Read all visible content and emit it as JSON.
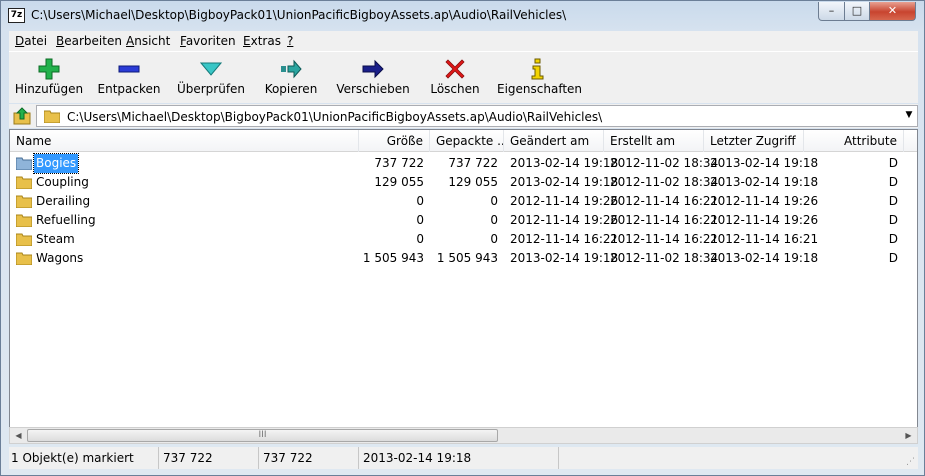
{
  "window": {
    "title": "C:\\Users\\Michael\\Desktop\\BigboyPack01\\UnionPacificBigboyAssets.ap\\Audio\\RailVehicles\\",
    "app_icon_text": "7z",
    "min_glyph": "–",
    "max_glyph": "□",
    "close_glyph": "✕"
  },
  "menu": [
    {
      "label": "Datei",
      "mnemonic": "D"
    },
    {
      "label": "Bearbeiten",
      "mnemonic": "B"
    },
    {
      "label": "Ansicht",
      "mnemonic": "A"
    },
    {
      "label": "Favoriten",
      "mnemonic": "F"
    },
    {
      "label": "Extras",
      "mnemonic": "E"
    },
    {
      "label": "?",
      "mnemonic": "?"
    }
  ],
  "toolbar": [
    {
      "label": "Hinzufügen",
      "icon": "add-icon"
    },
    {
      "label": "Entpacken",
      "icon": "extract-icon"
    },
    {
      "label": "Überprüfen",
      "icon": "test-icon"
    },
    {
      "label": "Kopieren",
      "icon": "copy-icon"
    },
    {
      "label": "Verschieben",
      "icon": "move-icon"
    },
    {
      "label": "Löschen",
      "icon": "delete-icon"
    },
    {
      "label": "Eigenschaften",
      "icon": "info-icon"
    }
  ],
  "address": {
    "path": "C:\\Users\\Michael\\Desktop\\BigboyPack01\\UnionPacificBigboyAssets.ap\\Audio\\RailVehicles\\",
    "dropdown_glyph": "▼"
  },
  "columns": [
    "Name",
    "Größe",
    "Gepackte ...",
    "Geändert am",
    "Erstellt am",
    "Letzter Zugriff",
    "Attribute"
  ],
  "rows": [
    {
      "name": "Bogies",
      "size": "737 722",
      "packed": "737 722",
      "modified": "2013-02-14 19:18",
      "created": "2012-11-02 18:34",
      "accessed": "2013-02-14 19:18",
      "attr": "D",
      "selected": true
    },
    {
      "name": "Coupling",
      "size": "129 055",
      "packed": "129 055",
      "modified": "2013-02-14 19:18",
      "created": "2012-11-02 18:34",
      "accessed": "2013-02-14 19:18",
      "attr": "D"
    },
    {
      "name": "Derailing",
      "size": "0",
      "packed": "0",
      "modified": "2012-11-14 19:26",
      "created": "2012-11-14 16:21",
      "accessed": "2012-11-14 19:26",
      "attr": "D"
    },
    {
      "name": "Refuelling",
      "size": "0",
      "packed": "0",
      "modified": "2012-11-14 19:26",
      "created": "2012-11-14 16:21",
      "accessed": "2012-11-14 19:26",
      "attr": "D"
    },
    {
      "name": "Steam",
      "size": "0",
      "packed": "0",
      "modified": "2012-11-14 16:21",
      "created": "2012-11-14 16:21",
      "accessed": "2012-11-14 16:21",
      "attr": "D"
    },
    {
      "name": "Wagons",
      "size": "1 505 943",
      "packed": "1 505 943",
      "modified": "2013-02-14 19:18",
      "created": "2012-11-02 18:34",
      "accessed": "2013-02-14 19:18",
      "attr": "D"
    }
  ],
  "scrollbar": {
    "left_glyph": "◀",
    "right_glyph": "▶",
    "thumb_grip": "III"
  },
  "status": {
    "selection": "1 Objekt(e) markiert",
    "size": "737 722",
    "packed": "737 722",
    "modified": "2013-02-14 19:18"
  },
  "colors": {
    "selection": "#3399ff",
    "folder": "#e8c04a"
  }
}
